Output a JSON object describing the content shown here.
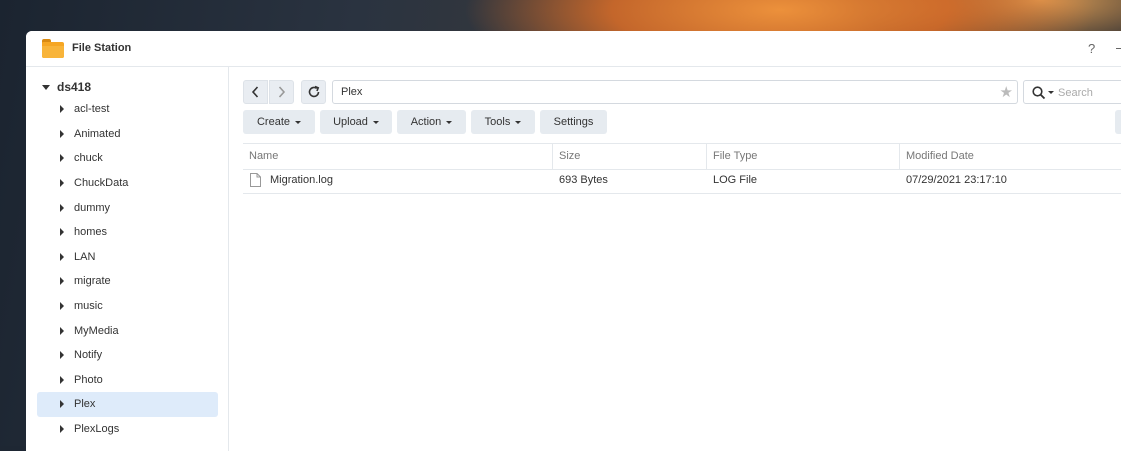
{
  "window": {
    "title": "File Station",
    "help_label": "?"
  },
  "sidebar": {
    "root": "ds418",
    "items": [
      {
        "label": "acl-test"
      },
      {
        "label": "Animated"
      },
      {
        "label": "chuck"
      },
      {
        "label": "ChuckData"
      },
      {
        "label": "dummy"
      },
      {
        "label": "homes"
      },
      {
        "label": "LAN"
      },
      {
        "label": "migrate"
      },
      {
        "label": "music"
      },
      {
        "label": "MyMedia"
      },
      {
        "label": "Notify"
      },
      {
        "label": "Photo"
      },
      {
        "label": "Plex",
        "selected": true
      },
      {
        "label": "PlexLogs"
      }
    ]
  },
  "nav": {
    "path": "Plex",
    "search_placeholder": "Search"
  },
  "toolbar": {
    "create": "Create",
    "upload": "Upload",
    "action": "Action",
    "tools": "Tools",
    "settings": "Settings"
  },
  "table": {
    "columns": [
      "Name",
      "Size",
      "File Type",
      "Modified Date"
    ],
    "rows": [
      {
        "name": "Migration.log",
        "size": "693 Bytes",
        "type": "LOG File",
        "modified": "07/29/2021 23:17:10"
      }
    ]
  },
  "colors": {
    "accent": "#f6a623",
    "selected_bg": "#deebfa",
    "button_bg": "#e6ebf0"
  },
  "icons": [
    "folder-icon",
    "chevron-left-icon",
    "chevron-right-icon",
    "refresh-icon",
    "star-icon",
    "search-icon",
    "file-icon",
    "caret-down-icon",
    "caret-right-icon"
  ]
}
